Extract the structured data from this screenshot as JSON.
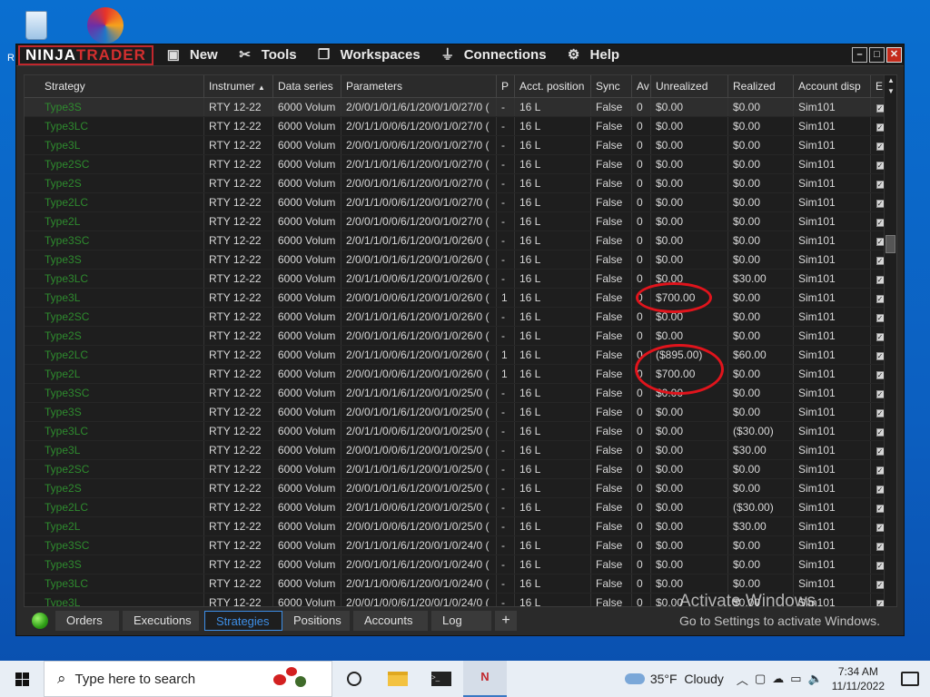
{
  "app": {
    "brand_left": "NINJA",
    "brand_right": "TRADER",
    "menu": [
      {
        "label": "New",
        "icon": "new-window-icon"
      },
      {
        "label": "Tools",
        "icon": "tools-icon"
      },
      {
        "label": "Workspaces",
        "icon": "workspaces-icon"
      },
      {
        "label": "Connections",
        "icon": "plug-icon"
      },
      {
        "label": "Help",
        "icon": "help-icon"
      }
    ]
  },
  "grid": {
    "headers": [
      "Strategy",
      "Instrumer",
      "Data series",
      "Parameters",
      "P",
      "Acct. position",
      "Sync",
      "Av",
      "Unrealized",
      "Realized",
      "Account disp",
      "E"
    ],
    "sort_indicator": "▲",
    "rows": [
      [
        "Type3S",
        "RTY 12-22",
        "6000 Volum",
        "2/0/0/1/0/1/6/1/20/0/1/0/27/0 (",
        "-",
        "16 L",
        "False",
        "0",
        "$0.00",
        "$0.00",
        "Sim101"
      ],
      [
        "Type3LC",
        "RTY 12-22",
        "6000 Volum",
        "2/0/1/1/0/0/6/1/20/0/1/0/27/0 (",
        "-",
        "16 L",
        "False",
        "0",
        "$0.00",
        "$0.00",
        "Sim101"
      ],
      [
        "Type3L",
        "RTY 12-22",
        "6000 Volum",
        "2/0/0/1/0/0/6/1/20/0/1/0/27/0 (",
        "-",
        "16 L",
        "False",
        "0",
        "$0.00",
        "$0.00",
        "Sim101"
      ],
      [
        "Type2SC",
        "RTY 12-22",
        "6000 Volum",
        "2/0/1/1/0/1/6/1/20/0/1/0/27/0 (",
        "-",
        "16 L",
        "False",
        "0",
        "$0.00",
        "$0.00",
        "Sim101"
      ],
      [
        "Type2S",
        "RTY 12-22",
        "6000 Volum",
        "2/0/0/1/0/1/6/1/20/0/1/0/27/0 (",
        "-",
        "16 L",
        "False",
        "0",
        "$0.00",
        "$0.00",
        "Sim101"
      ],
      [
        "Type2LC",
        "RTY 12-22",
        "6000 Volum",
        "2/0/1/1/0/0/6/1/20/0/1/0/27/0 (",
        "-",
        "16 L",
        "False",
        "0",
        "$0.00",
        "$0.00",
        "Sim101"
      ],
      [
        "Type2L",
        "RTY 12-22",
        "6000 Volum",
        "2/0/0/1/0/0/6/1/20/0/1/0/27/0 (",
        "-",
        "16 L",
        "False",
        "0",
        "$0.00",
        "$0.00",
        "Sim101"
      ],
      [
        "Type3SC",
        "RTY 12-22",
        "6000 Volum",
        "2/0/1/1/0/1/6/1/20/0/1/0/26/0 (",
        "-",
        "16 L",
        "False",
        "0",
        "$0.00",
        "$0.00",
        "Sim101"
      ],
      [
        "Type3S",
        "RTY 12-22",
        "6000 Volum",
        "2/0/0/1/0/1/6/1/20/0/1/0/26/0 (",
        "-",
        "16 L",
        "False",
        "0",
        "$0.00",
        "$0.00",
        "Sim101"
      ],
      [
        "Type3LC",
        "RTY 12-22",
        "6000 Volum",
        "2/0/1/1/0/0/6/1/20/0/1/0/26/0 (",
        "-",
        "16 L",
        "False",
        "0",
        "$0.00",
        "$30.00",
        "Sim101"
      ],
      [
        "Type3L",
        "RTY 12-22",
        "6000 Volum",
        "2/0/0/1/0/0/6/1/20/0/1/0/26/0 (",
        "1",
        "16 L",
        "False",
        "0",
        "$700.00",
        "$0.00",
        "Sim101"
      ],
      [
        "Type2SC",
        "RTY 12-22",
        "6000 Volum",
        "2/0/1/1/0/1/6/1/20/0/1/0/26/0 (",
        "-",
        "16 L",
        "False",
        "0",
        "$0.00",
        "$0.00",
        "Sim101"
      ],
      [
        "Type2S",
        "RTY 12-22",
        "6000 Volum",
        "2/0/0/1/0/1/6/1/20/0/1/0/26/0 (",
        "-",
        "16 L",
        "False",
        "0",
        "$0.00",
        "$0.00",
        "Sim101"
      ],
      [
        "Type2LC",
        "RTY 12-22",
        "6000 Volum",
        "2/0/1/1/0/0/6/1/20/0/1/0/26/0 (",
        "1",
        "16 L",
        "False",
        "0",
        "($895.00)",
        "$60.00",
        "Sim101"
      ],
      [
        "Type2L",
        "RTY 12-22",
        "6000 Volum",
        "2/0/0/1/0/0/6/1/20/0/1/0/26/0 (",
        "1",
        "16 L",
        "False",
        "0",
        "$700.00",
        "$0.00",
        "Sim101"
      ],
      [
        "Type3SC",
        "RTY 12-22",
        "6000 Volum",
        "2/0/1/1/0/1/6/1/20/0/1/0/25/0 (",
        "-",
        "16 L",
        "False",
        "0",
        "$0.00",
        "$0.00",
        "Sim101"
      ],
      [
        "Type3S",
        "RTY 12-22",
        "6000 Volum",
        "2/0/0/1/0/1/6/1/20/0/1/0/25/0 (",
        "-",
        "16 L",
        "False",
        "0",
        "$0.00",
        "$0.00",
        "Sim101"
      ],
      [
        "Type3LC",
        "RTY 12-22",
        "6000 Volum",
        "2/0/1/1/0/0/6/1/20/0/1/0/25/0 (",
        "-",
        "16 L",
        "False",
        "0",
        "$0.00",
        "($30.00)",
        "Sim101"
      ],
      [
        "Type3L",
        "RTY 12-22",
        "6000 Volum",
        "2/0/0/1/0/0/6/1/20/0/1/0/25/0 (",
        "-",
        "16 L",
        "False",
        "0",
        "$0.00",
        "$30.00",
        "Sim101"
      ],
      [
        "Type2SC",
        "RTY 12-22",
        "6000 Volum",
        "2/0/1/1/0/1/6/1/20/0/1/0/25/0 (",
        "-",
        "16 L",
        "False",
        "0",
        "$0.00",
        "$0.00",
        "Sim101"
      ],
      [
        "Type2S",
        "RTY 12-22",
        "6000 Volum",
        "2/0/0/1/0/1/6/1/20/0/1/0/25/0 (",
        "-",
        "16 L",
        "False",
        "0",
        "$0.00",
        "$0.00",
        "Sim101"
      ],
      [
        "Type2LC",
        "RTY 12-22",
        "6000 Volum",
        "2/0/1/1/0/0/6/1/20/0/1/0/25/0 (",
        "-",
        "16 L",
        "False",
        "0",
        "$0.00",
        "($30.00)",
        "Sim101"
      ],
      [
        "Type2L",
        "RTY 12-22",
        "6000 Volum",
        "2/0/0/1/0/0/6/1/20/0/1/0/25/0 (",
        "-",
        "16 L",
        "False",
        "0",
        "$0.00",
        "$30.00",
        "Sim101"
      ],
      [
        "Type3SC",
        "RTY 12-22",
        "6000 Volum",
        "2/0/1/1/0/1/6/1/20/0/1/0/24/0 (",
        "-",
        "16 L",
        "False",
        "0",
        "$0.00",
        "$0.00",
        "Sim101"
      ],
      [
        "Type3S",
        "RTY 12-22",
        "6000 Volum",
        "2/0/0/1/0/1/6/1/20/0/1/0/24/0 (",
        "-",
        "16 L",
        "False",
        "0",
        "$0.00",
        "$0.00",
        "Sim101"
      ],
      [
        "Type3LC",
        "RTY 12-22",
        "6000 Volum",
        "2/0/1/1/0/0/6/1/20/0/1/0/24/0 (",
        "-",
        "16 L",
        "False",
        "0",
        "$0.00",
        "$0.00",
        "Sim101"
      ],
      [
        "Type3L",
        "RTY 12-22",
        "6000 Volum",
        "2/0/0/1/0/0/6/1/20/0/1/0/24/0 (",
        "-",
        "16 L",
        "False",
        "0",
        "$0.00",
        "$0.00",
        "Sim101"
      ]
    ]
  },
  "tabs": {
    "orders": "Orders",
    "executions": "Executions",
    "strategies": "Strategies",
    "positions": "Positions",
    "accounts": "Accounts",
    "log": "Log",
    "add": "+"
  },
  "watermark": {
    "line1": "Activate Windows",
    "line2": "Go to Settings to activate Windows."
  },
  "taskbar": {
    "search_placeholder": "Type here to search",
    "weather_temp": "35°F",
    "weather_text": "Cloudy",
    "time": "7:34 AM",
    "date": "11/11/2022"
  },
  "annotation_color": "#e0141c",
  "strategy_name_color": "#2e8b2e"
}
